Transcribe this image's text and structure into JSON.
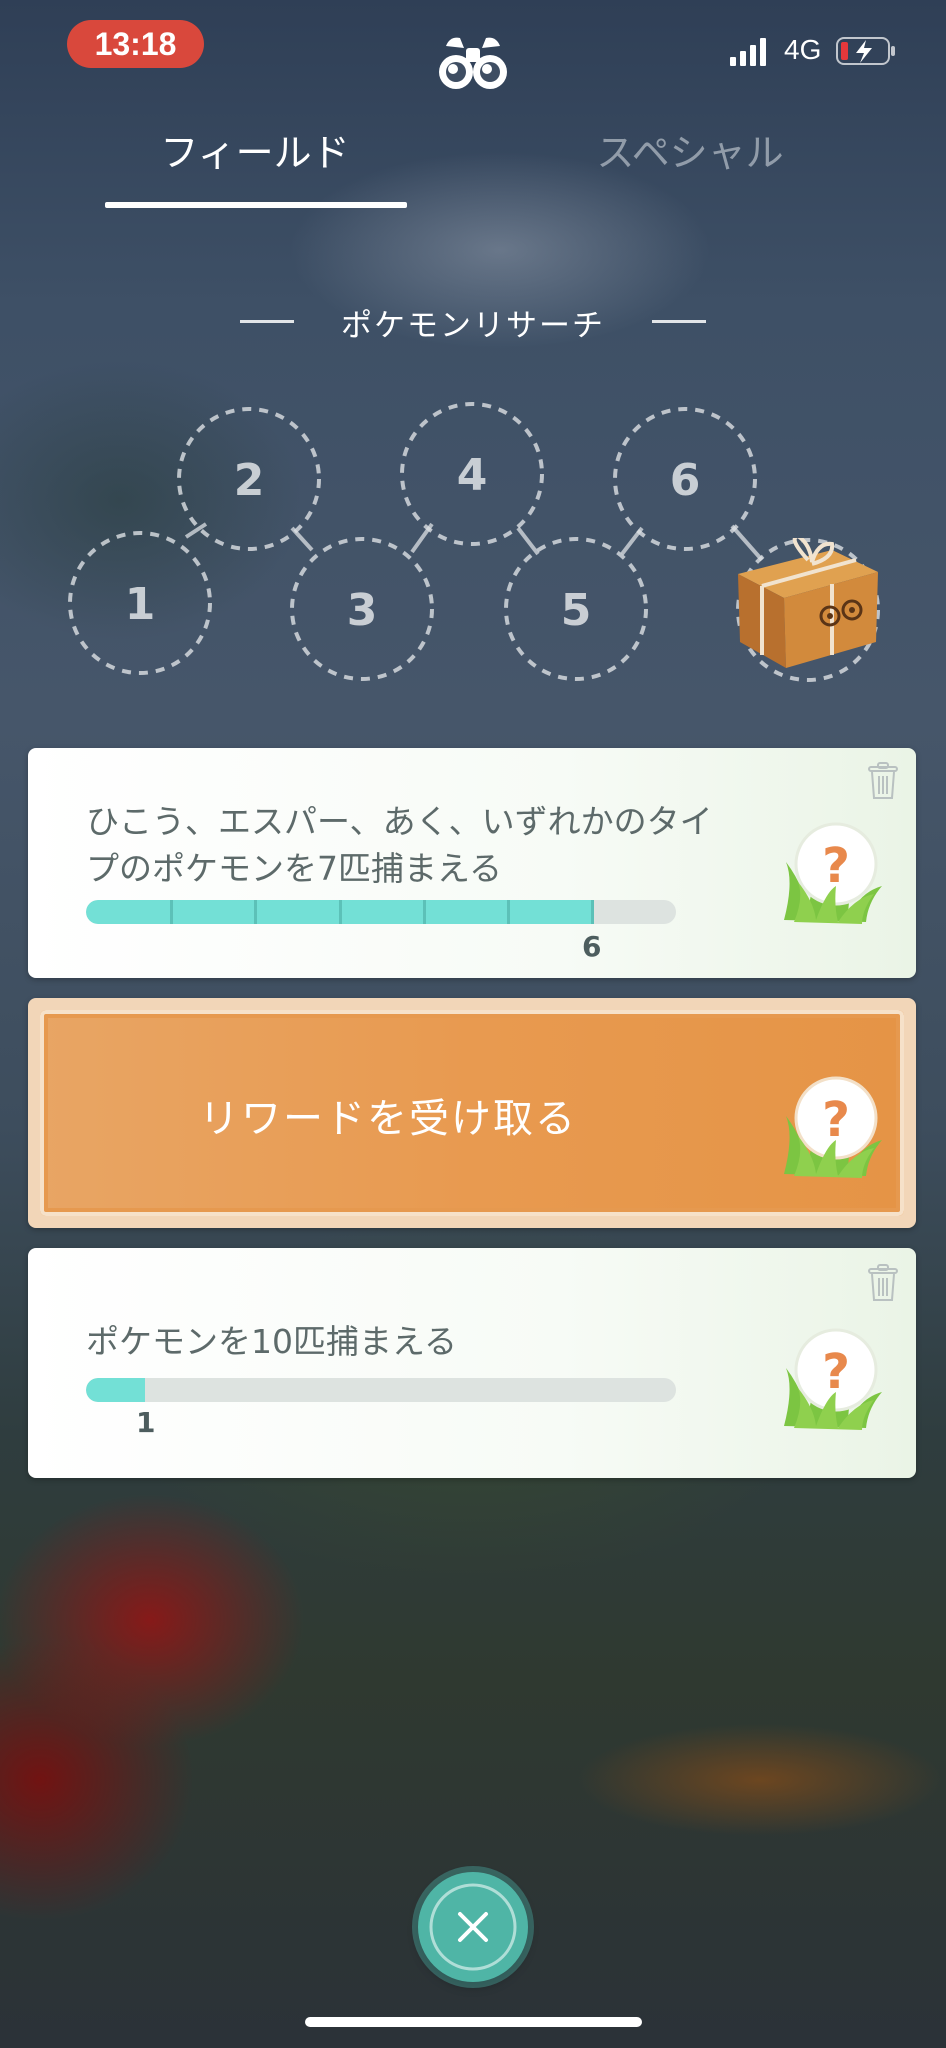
{
  "status_bar": {
    "time": "13:18",
    "network": "4G",
    "signal_icon": "signal-bars-icon",
    "battery_icon": "battery-charging-low-icon"
  },
  "header": {
    "icon": "binoculars-icon"
  },
  "tabs": [
    {
      "label": "フィールド",
      "active": true
    },
    {
      "label": "スペシャル",
      "active": false
    }
  ],
  "section": {
    "title": "ポケモンリサーチ"
  },
  "stamps": {
    "labels": [
      "1",
      "2",
      "3",
      "4",
      "5",
      "6"
    ],
    "reward_icon": "gift-box-icon"
  },
  "tasks": [
    {
      "text": "ひこう、エスパー、あく、いずれかのタイプのポケモンを7匹捕まえる",
      "progress_current": "6",
      "progress_total": 7,
      "reward_icon": "mystery-reward-icon",
      "delete_icon": "trash-icon"
    },
    {
      "text": "ポケモンを10匹捕まえる",
      "progress_current": "1",
      "progress_total": 10,
      "reward_icon": "mystery-reward-icon",
      "delete_icon": "trash-icon"
    }
  ],
  "claim": {
    "label": "リワードを受け取る",
    "reward_icon": "mystery-reward-icon"
  },
  "close": {
    "icon": "close-icon"
  },
  "colors": {
    "progress": "#73e0d6",
    "claim": "#e89a50",
    "status_time_bg": "#d9483c",
    "close": "#4fb5a6"
  }
}
